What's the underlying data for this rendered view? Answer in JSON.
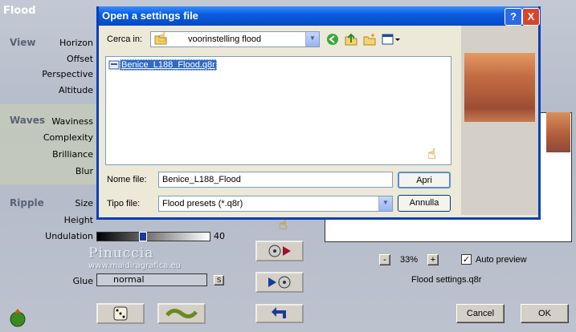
{
  "plugin": {
    "title": "Flood",
    "sections": {
      "view": "View",
      "waves": "Waves",
      "ripple": "Ripple"
    },
    "params": {
      "horizon": "Horizon",
      "offset": "Offset",
      "perspective": "Perspective",
      "altitude": "Altitude",
      "waviness": "Waviness",
      "complexity": "Complexity",
      "brilliance": "Brilliance",
      "blur": "Blur",
      "size": "Size",
      "height": "Height",
      "undulation": "Undulation",
      "undulation_value": "40",
      "undulation_level": 0.4,
      "glue": "Glue",
      "glue_value": "normal",
      "glue_s": "S"
    },
    "watermark": {
      "line1": "Pinuccia",
      "line2": "www.maidiragrafica.eu"
    },
    "zoom": {
      "minus": "-",
      "value": "33%",
      "plus": "+"
    },
    "auto_preview": {
      "label": "Auto preview",
      "checked": true
    },
    "settings_file": "Flood settings.q8r",
    "cancel": "Cancel",
    "ok": "OK"
  },
  "dialog": {
    "title": "Open a settings file",
    "help": "?",
    "close": "X",
    "look_in_label": "Cerca in:",
    "look_in_value": "voorinstelling flood",
    "file": "Benice_L188_Flood.q8r",
    "filename_label": "Nome file:",
    "filename_value": "Benice_L188_Flood",
    "filetype_label": "Tipo file:",
    "filetype_value": "Flood presets (*.q8r)",
    "open": "Apri",
    "cancel": "Annulla"
  },
  "colors": {
    "titlebar": "#0a5ee0",
    "selection": "#316ac5"
  }
}
